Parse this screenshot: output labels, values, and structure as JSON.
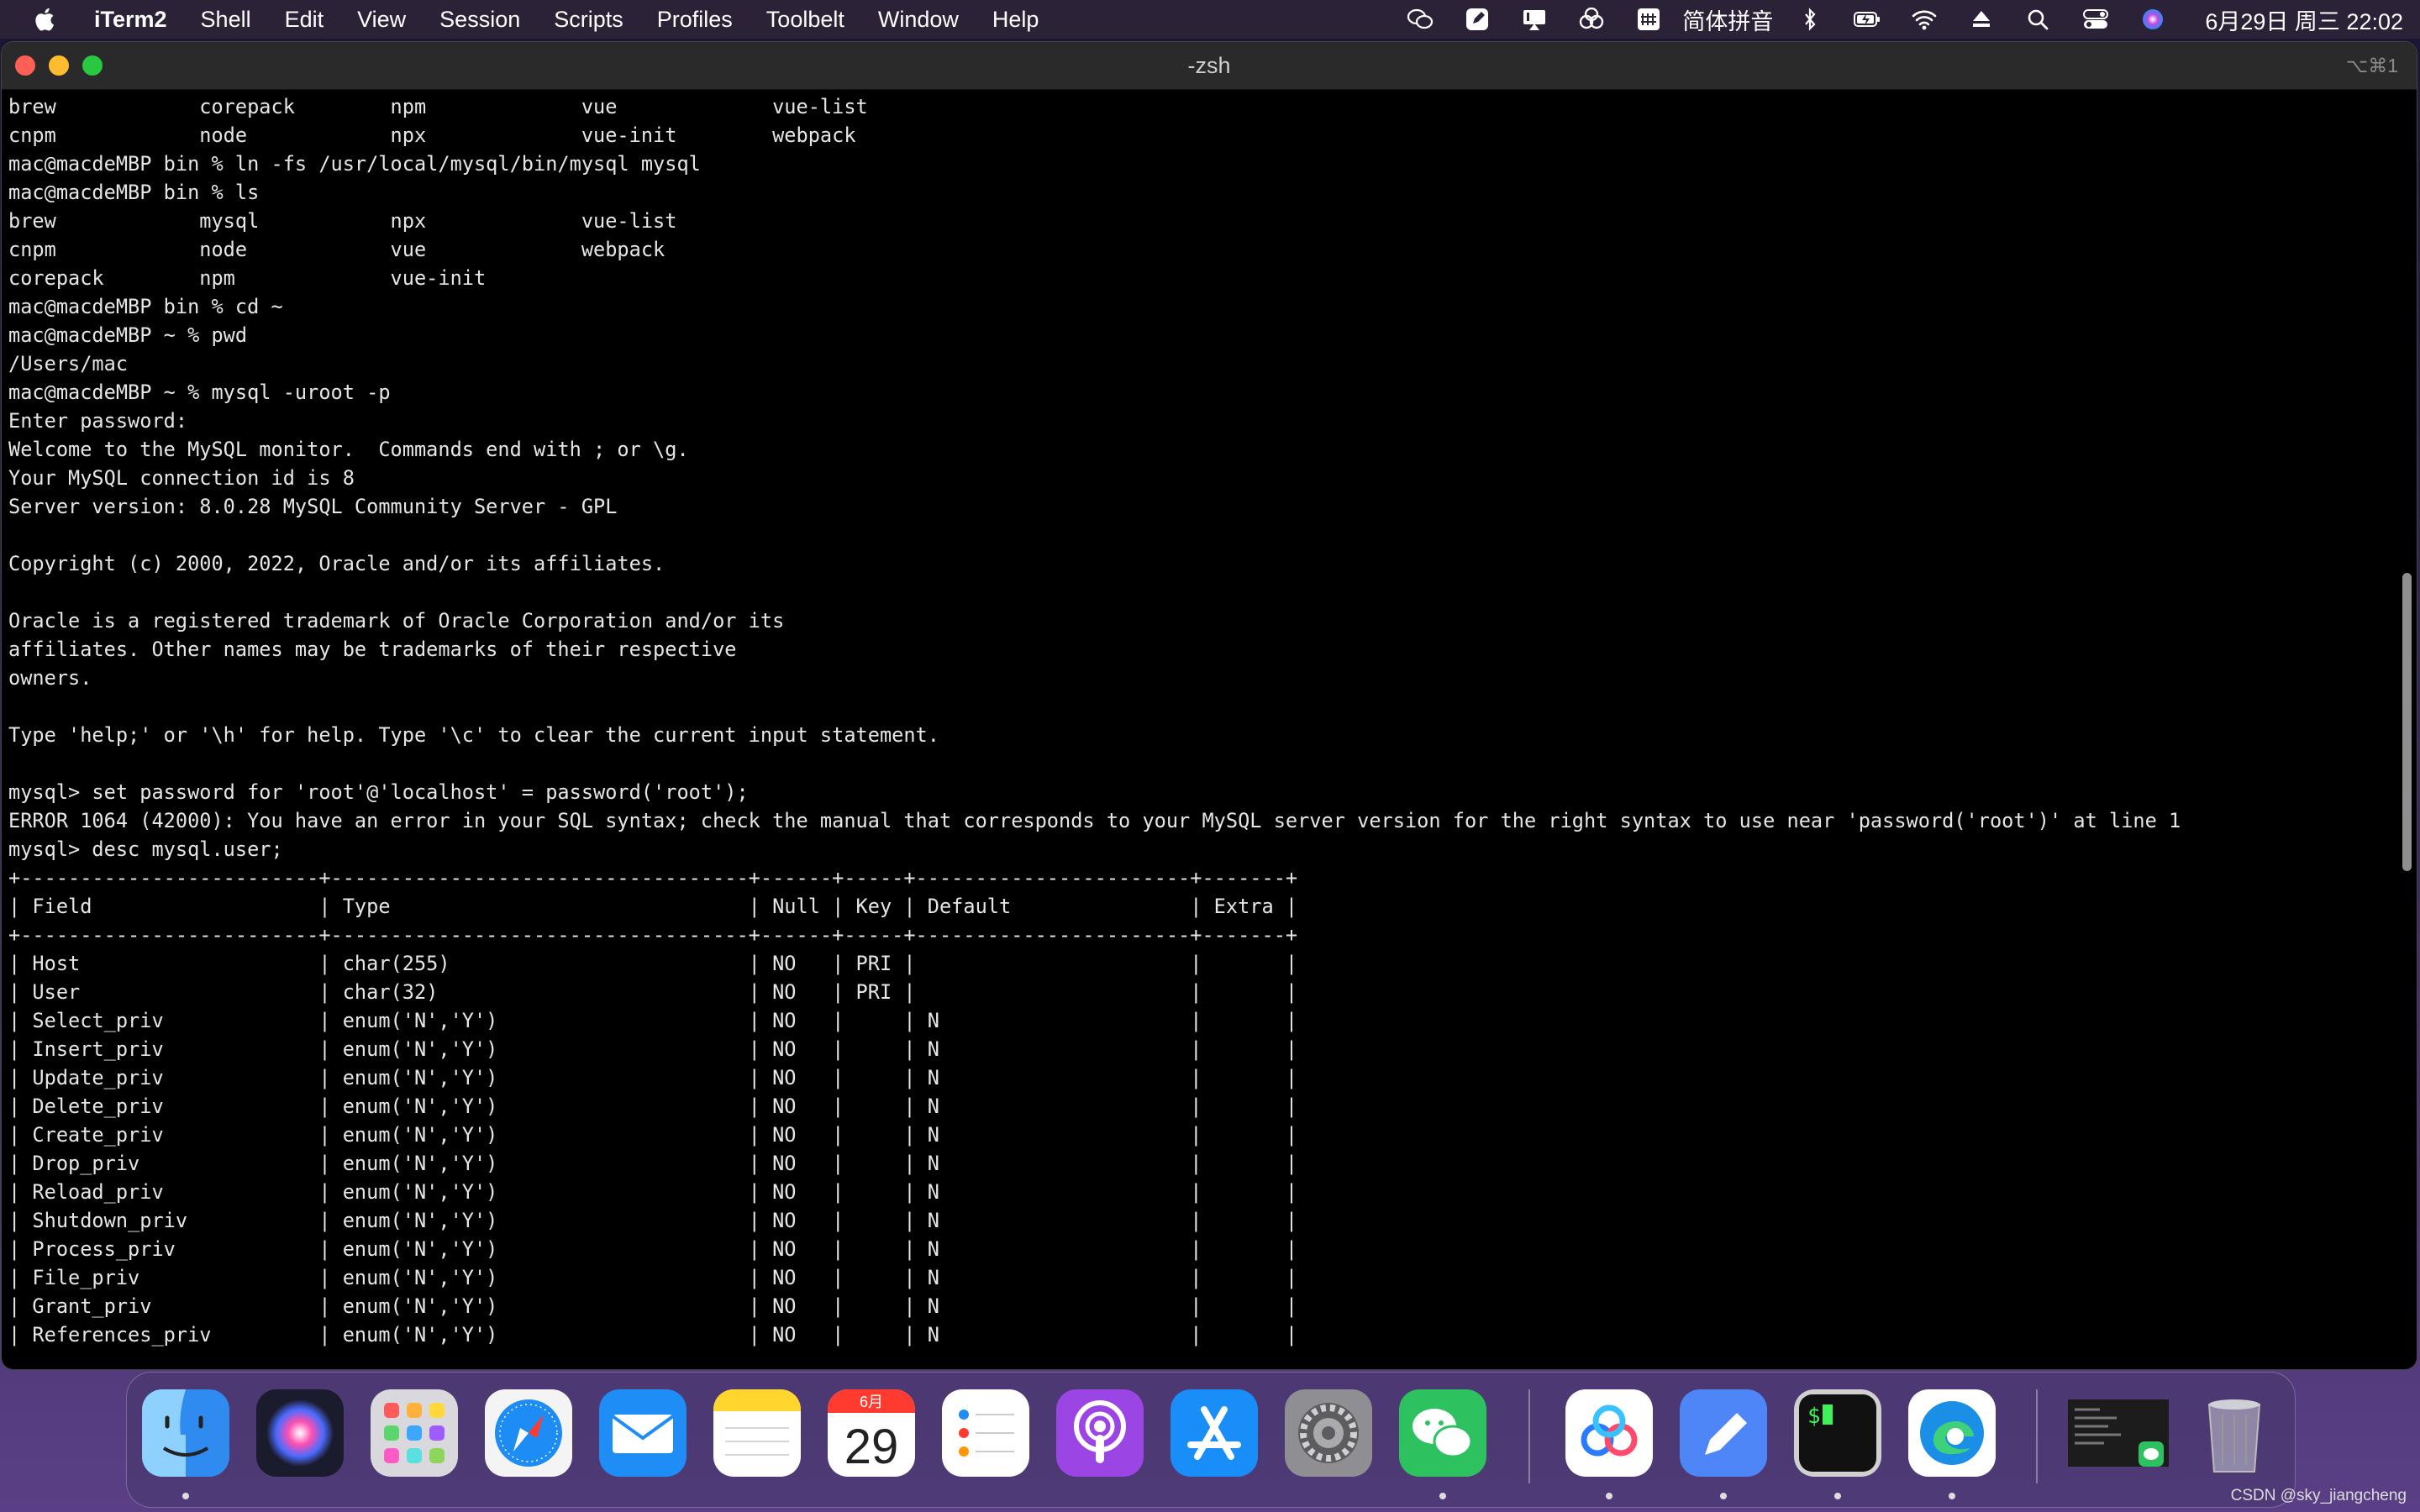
{
  "menubar": {
    "app_name": "iTerm2",
    "items": [
      "Shell",
      "Edit",
      "View",
      "Session",
      "Scripts",
      "Profiles",
      "Toolbelt",
      "Window",
      "Help"
    ],
    "status_icons": [
      "wechat-icon",
      "pen-icon",
      "airplay-icon",
      "baidu-netdisk-icon",
      "input-method-icon",
      "bluetooth-icon",
      "battery-charging-icon",
      "wifi-icon",
      "eject-icon",
      "search-icon",
      "control-center-icon",
      "siri-icon"
    ],
    "ime_label": "简体拼音",
    "clock": "6月29日 周三  22:02"
  },
  "window": {
    "title": "-zsh",
    "shortcut": "⌥⌘1"
  },
  "terminal": {
    "lines": [
      "brew            corepack        npm             vue             vue-list",
      "cnpm            node            npx             vue-init        webpack",
      "mac@macdeMBP bin % ln -fs /usr/local/mysql/bin/mysql mysql",
      "mac@macdeMBP bin % ls",
      "brew            mysql           npx             vue-list",
      "cnpm            node            vue             webpack",
      "corepack        npm             vue-init",
      "mac@macdeMBP bin % cd ~",
      "mac@macdeMBP ~ % pwd",
      "/Users/mac",
      "mac@macdeMBP ~ % mysql -uroot -p",
      "Enter password:",
      "Welcome to the MySQL monitor.  Commands end with ; or \\g.",
      "Your MySQL connection id is 8",
      "Server version: 8.0.28 MySQL Community Server - GPL",
      "",
      "Copyright (c) 2000, 2022, Oracle and/or its affiliates.",
      "",
      "Oracle is a registered trademark of Oracle Corporation and/or its",
      "affiliates. Other names may be trademarks of their respective",
      "owners.",
      "",
      "Type 'help;' or '\\h' for help. Type '\\c' to clear the current input statement.",
      "",
      "mysql> set password for 'root'@'localhost' = password('root');",
      "ERROR 1064 (42000): You have an error in your SQL syntax; check the manual that corresponds to your MySQL server version for the right syntax to use near 'password('root')' at line 1",
      "mysql> desc mysql.user;",
      "+-------------------------+-----------------------------------+------+-----+-----------------------+-------+",
      "| Field                   | Type                              | Null | Key | Default               | Extra |",
      "+-------------------------+-----------------------------------+------+-----+-----------------------+-------+",
      "| Host                    | char(255)                         | NO   | PRI |                       |       |",
      "| User                    | char(32)                          | NO   | PRI |                       |       |",
      "| Select_priv             | enum('N','Y')                     | NO   |     | N                     |       |",
      "| Insert_priv             | enum('N','Y')                     | NO   |     | N                     |       |",
      "| Update_priv             | enum('N','Y')                     | NO   |     | N                     |       |",
      "| Delete_priv             | enum('N','Y')                     | NO   |     | N                     |       |",
      "| Create_priv             | enum('N','Y')                     | NO   |     | N                     |       |",
      "| Drop_priv               | enum('N','Y')                     | NO   |     | N                     |       |",
      "| Reload_priv             | enum('N','Y')                     | NO   |     | N                     |       |",
      "| Shutdown_priv           | enum('N','Y')                     | NO   |     | N                     |       |",
      "| Process_priv            | enum('N','Y')                     | NO   |     | N                     |       |",
      "| File_priv               | enum('N','Y')                     | NO   |     | N                     |       |",
      "| Grant_priv              | enum('N','Y')                     | NO   |     | N                     |       |",
      "| References_priv         | enum('N','Y')                     | NO   |     | N                     |       |"
    ]
  },
  "dock": {
    "apps": [
      {
        "name": "finder",
        "running": true
      },
      {
        "name": "siri",
        "running": false
      },
      {
        "name": "launchpad",
        "running": false
      },
      {
        "name": "safari",
        "running": false
      },
      {
        "name": "mail",
        "running": false
      },
      {
        "name": "notes",
        "running": false
      },
      {
        "name": "calendar",
        "running": false,
        "month": "6月",
        "day": "29"
      },
      {
        "name": "reminders",
        "running": false
      },
      {
        "name": "podcasts",
        "running": false
      },
      {
        "name": "app-store",
        "running": false
      },
      {
        "name": "system-preferences",
        "running": false
      },
      {
        "name": "wechat",
        "running": true
      },
      {
        "name": "baidu-netdisk",
        "running": true
      },
      {
        "name": "pen-app",
        "running": true
      },
      {
        "name": "iterm2",
        "running": true
      },
      {
        "name": "edge",
        "running": true
      },
      {
        "name": "wechat-window-preview",
        "running": false
      },
      {
        "name": "trash",
        "running": false
      }
    ]
  },
  "watermark": "CSDN @sky_jiangcheng"
}
